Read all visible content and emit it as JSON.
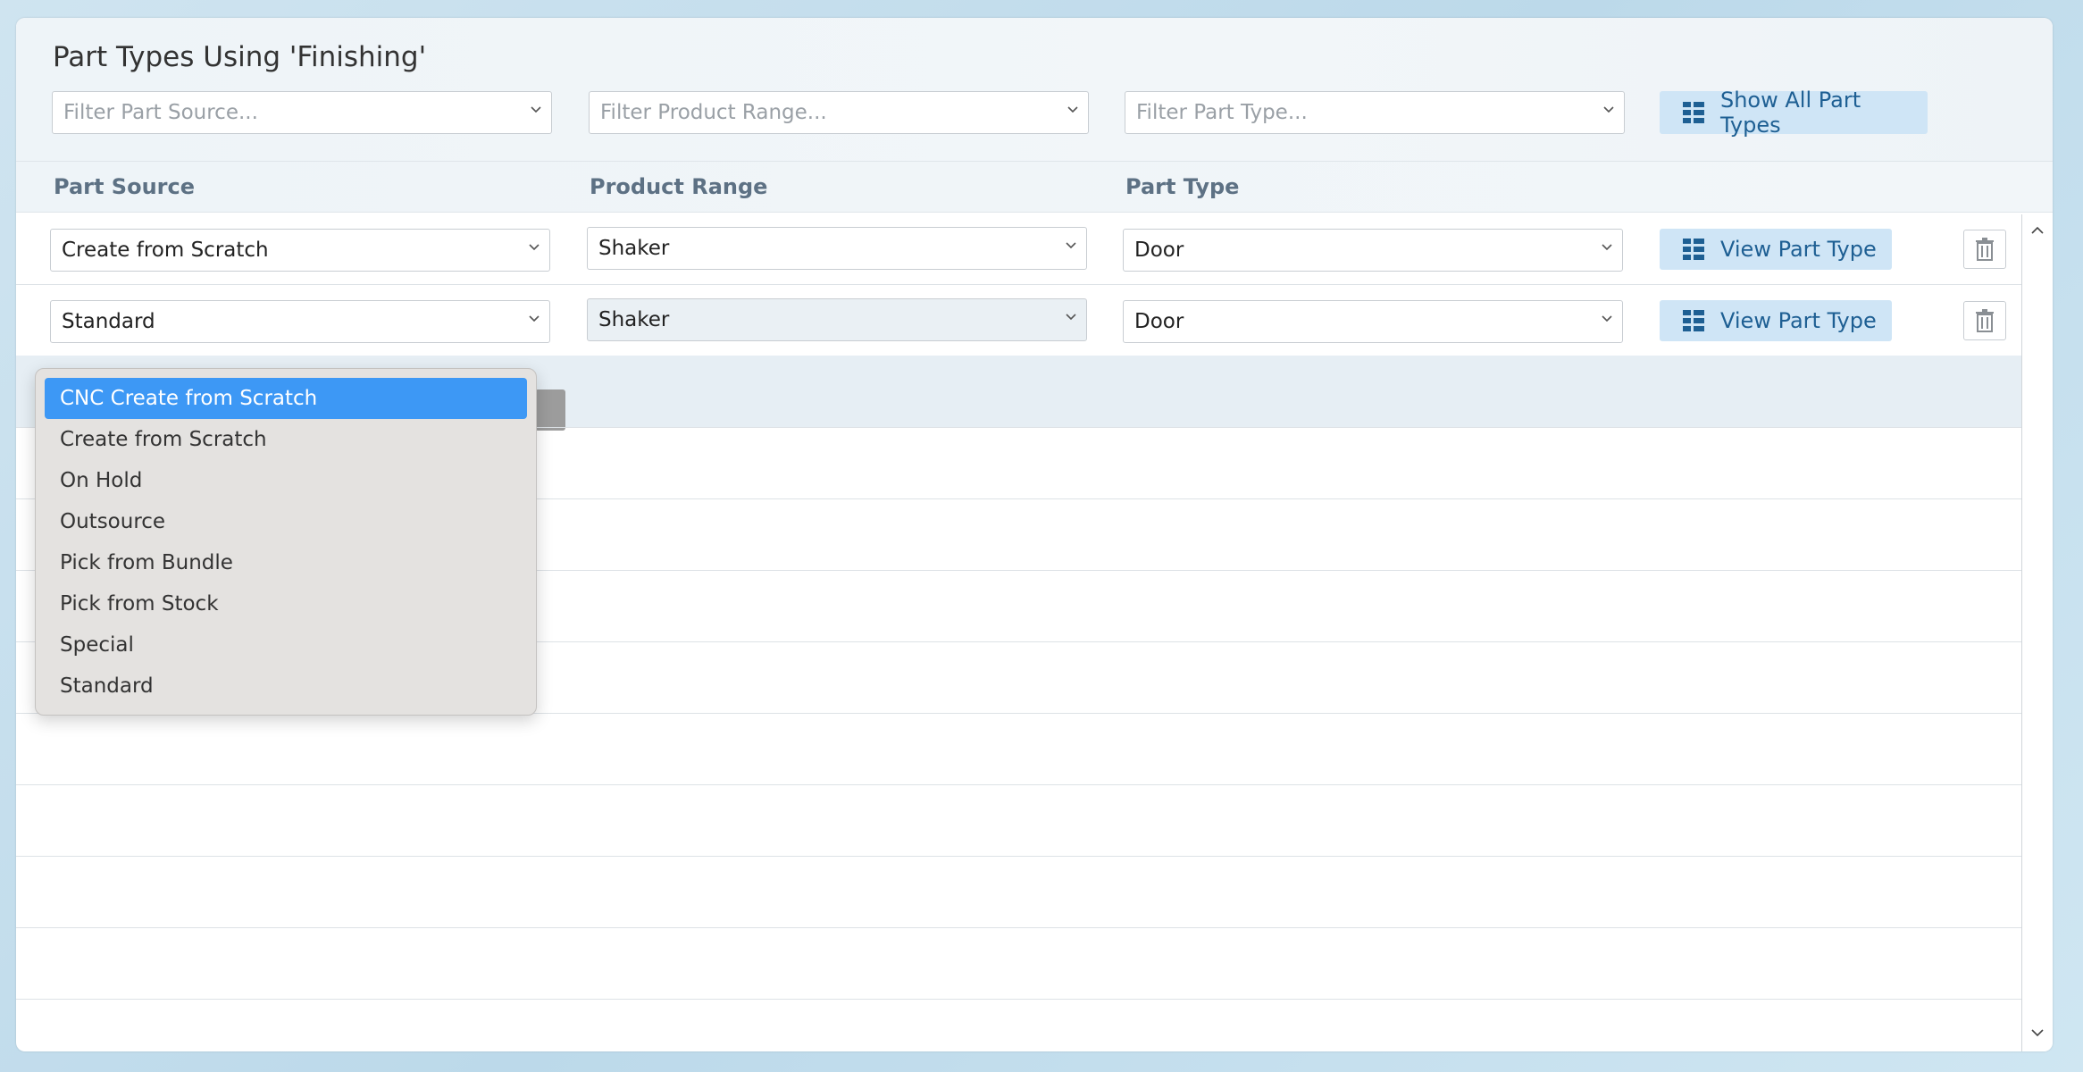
{
  "title": "Part Types Using 'Finishing'",
  "filters": {
    "part_source_placeholder": "Filter Part Source...",
    "product_range_placeholder": "Filter Product Range...",
    "part_type_placeholder": "Filter Part Type...",
    "show_all_label": "Show All Part Types"
  },
  "columns": {
    "part_source": "Part Source",
    "product_range": "Product Range",
    "part_type": "Part Type"
  },
  "rows": [
    {
      "part_source": "Create from Scratch",
      "product_range": "Shaker",
      "part_type": "Door",
      "view_label": "View Part Type"
    },
    {
      "part_source": "Standard",
      "product_range": "Shaker",
      "part_type": "Door",
      "view_label": "View Part Type"
    }
  ],
  "dropdown": {
    "selected_index": 0,
    "options": [
      "CNC Create from Scratch",
      "Create from Scratch",
      "On Hold",
      "Outsource",
      "Pick from Bundle",
      "Pick from Stock",
      "Special",
      "Standard"
    ]
  },
  "icons": {
    "grid": "grid-icon",
    "trash": "trash-icon",
    "chevron": "chevron-down-icon"
  },
  "colors": {
    "accent": "#3d98f5",
    "button_bg": "#cfe5f6",
    "button_text": "#1e5f93"
  }
}
